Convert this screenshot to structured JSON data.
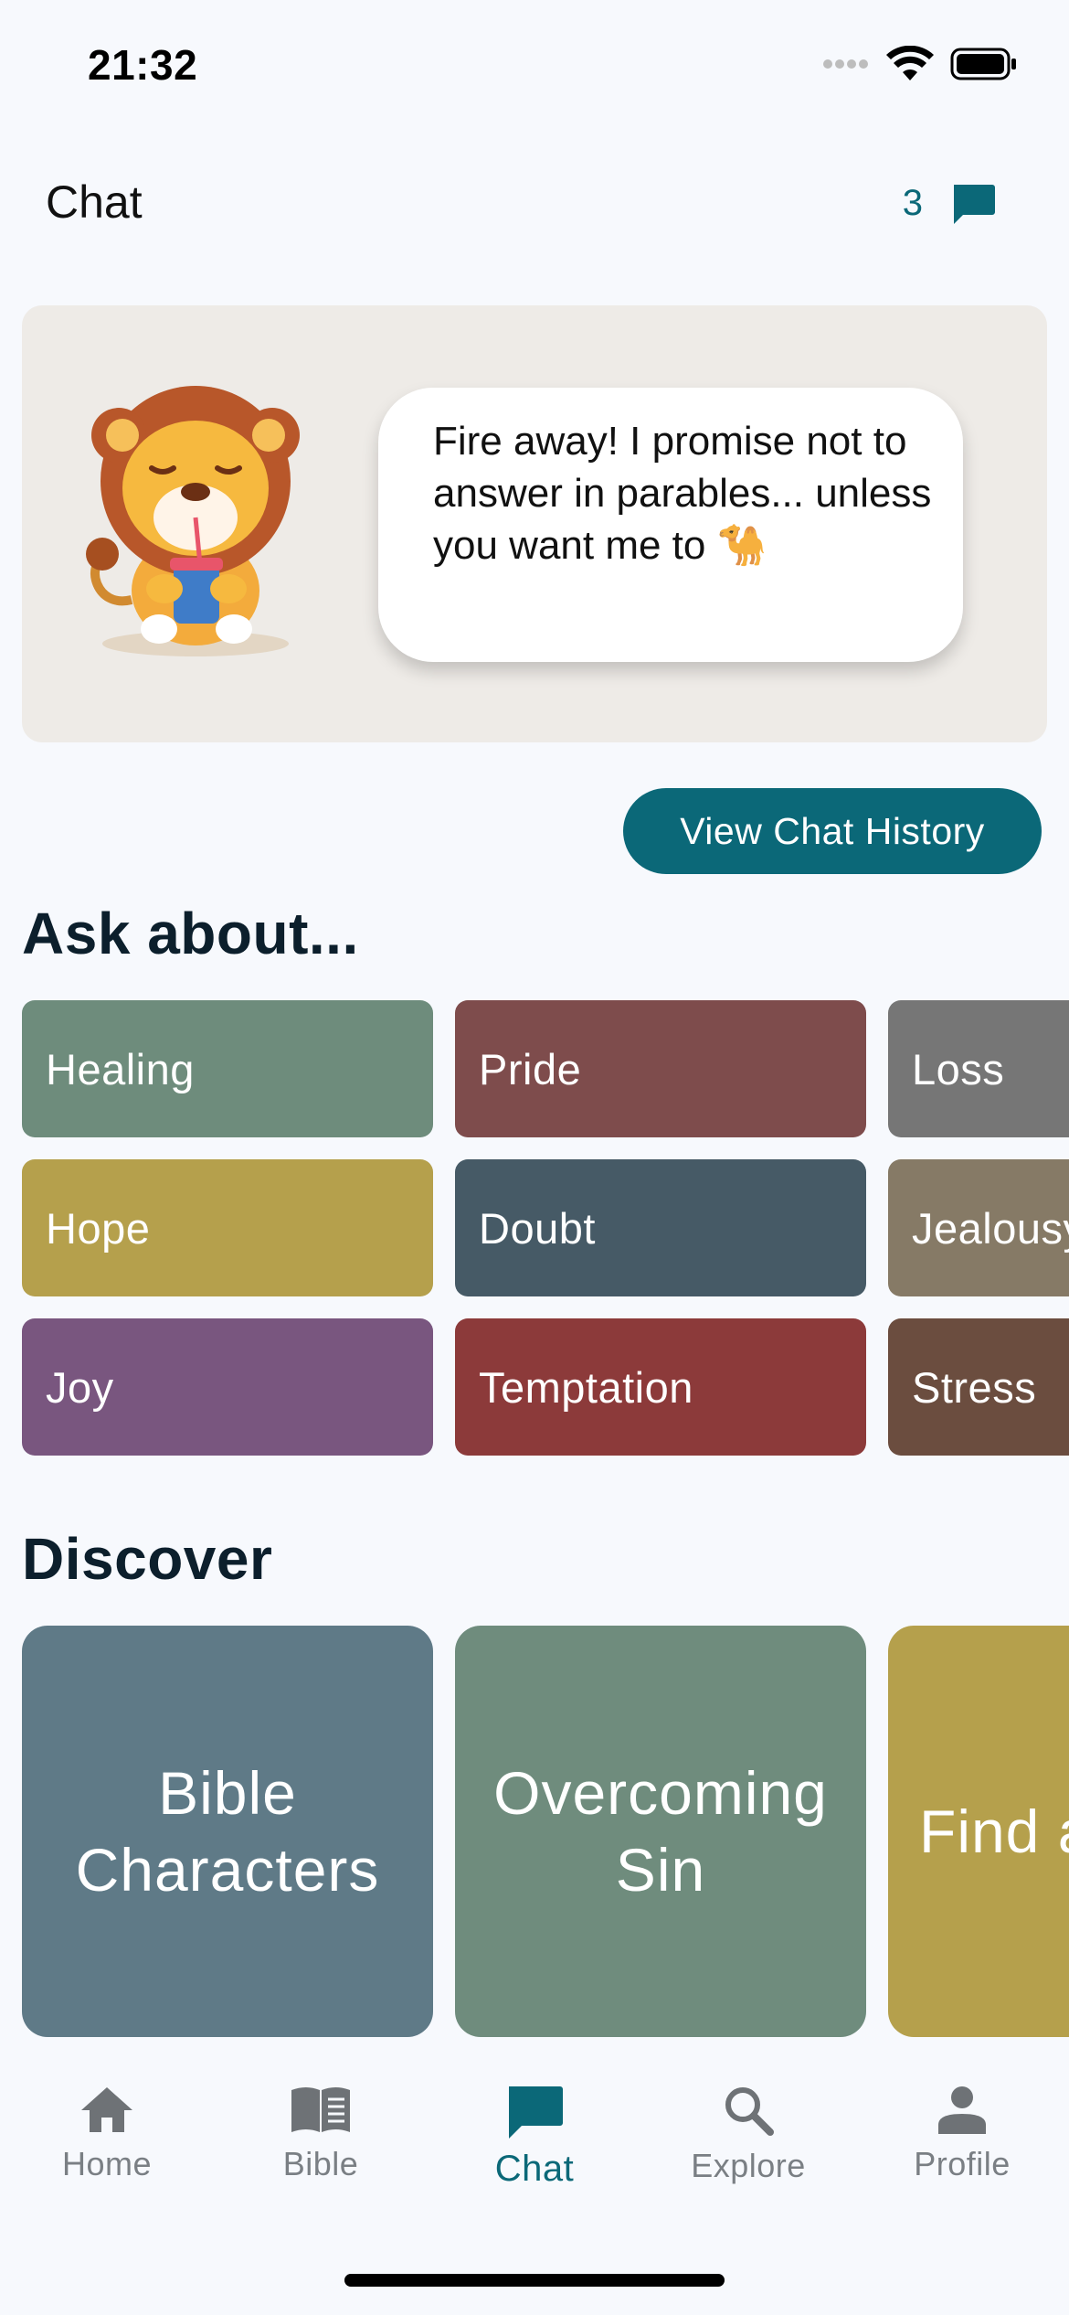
{
  "status_bar": {
    "time": "21:32"
  },
  "header": {
    "title": "Chat",
    "chat_count": "3"
  },
  "banner": {
    "message": "Fire away! I promise not to answer in parables... unless you want me to 🐪"
  },
  "history_button": {
    "label": "View Chat History"
  },
  "ask_section": {
    "title": "Ask about...",
    "topics": [
      {
        "label": "Healing",
        "color": "#6e8c7c"
      },
      {
        "label": "Pride",
        "color": "#7e4c4c"
      },
      {
        "label": "Loss",
        "color": "#767676"
      },
      {
        "label": "Hope",
        "color": "#b5a04c"
      },
      {
        "label": "Doubt",
        "color": "#465a66"
      },
      {
        "label": "Jealousy",
        "color": "#867a66"
      },
      {
        "label": "Joy",
        "color": "#79567f"
      },
      {
        "label": "Temptation",
        "color": "#8c3a3a"
      },
      {
        "label": "Stress",
        "color": "#6b4d3f"
      }
    ]
  },
  "discover_section": {
    "title": "Discover",
    "cards": [
      {
        "label": "Bible Characters",
        "color": "#5f7a87"
      },
      {
        "label": "Overcoming Sin",
        "color": "#6f8c7d"
      },
      {
        "label": "Find a",
        "color": "#b5a04c"
      }
    ]
  },
  "tab_bar": {
    "tabs": [
      {
        "label": "Home",
        "icon": "home-icon"
      },
      {
        "label": "Bible",
        "icon": "book-icon"
      },
      {
        "label": "Chat",
        "icon": "chat-icon",
        "active": true
      },
      {
        "label": "Explore",
        "icon": "search-icon"
      },
      {
        "label": "Profile",
        "icon": "person-icon"
      }
    ]
  }
}
